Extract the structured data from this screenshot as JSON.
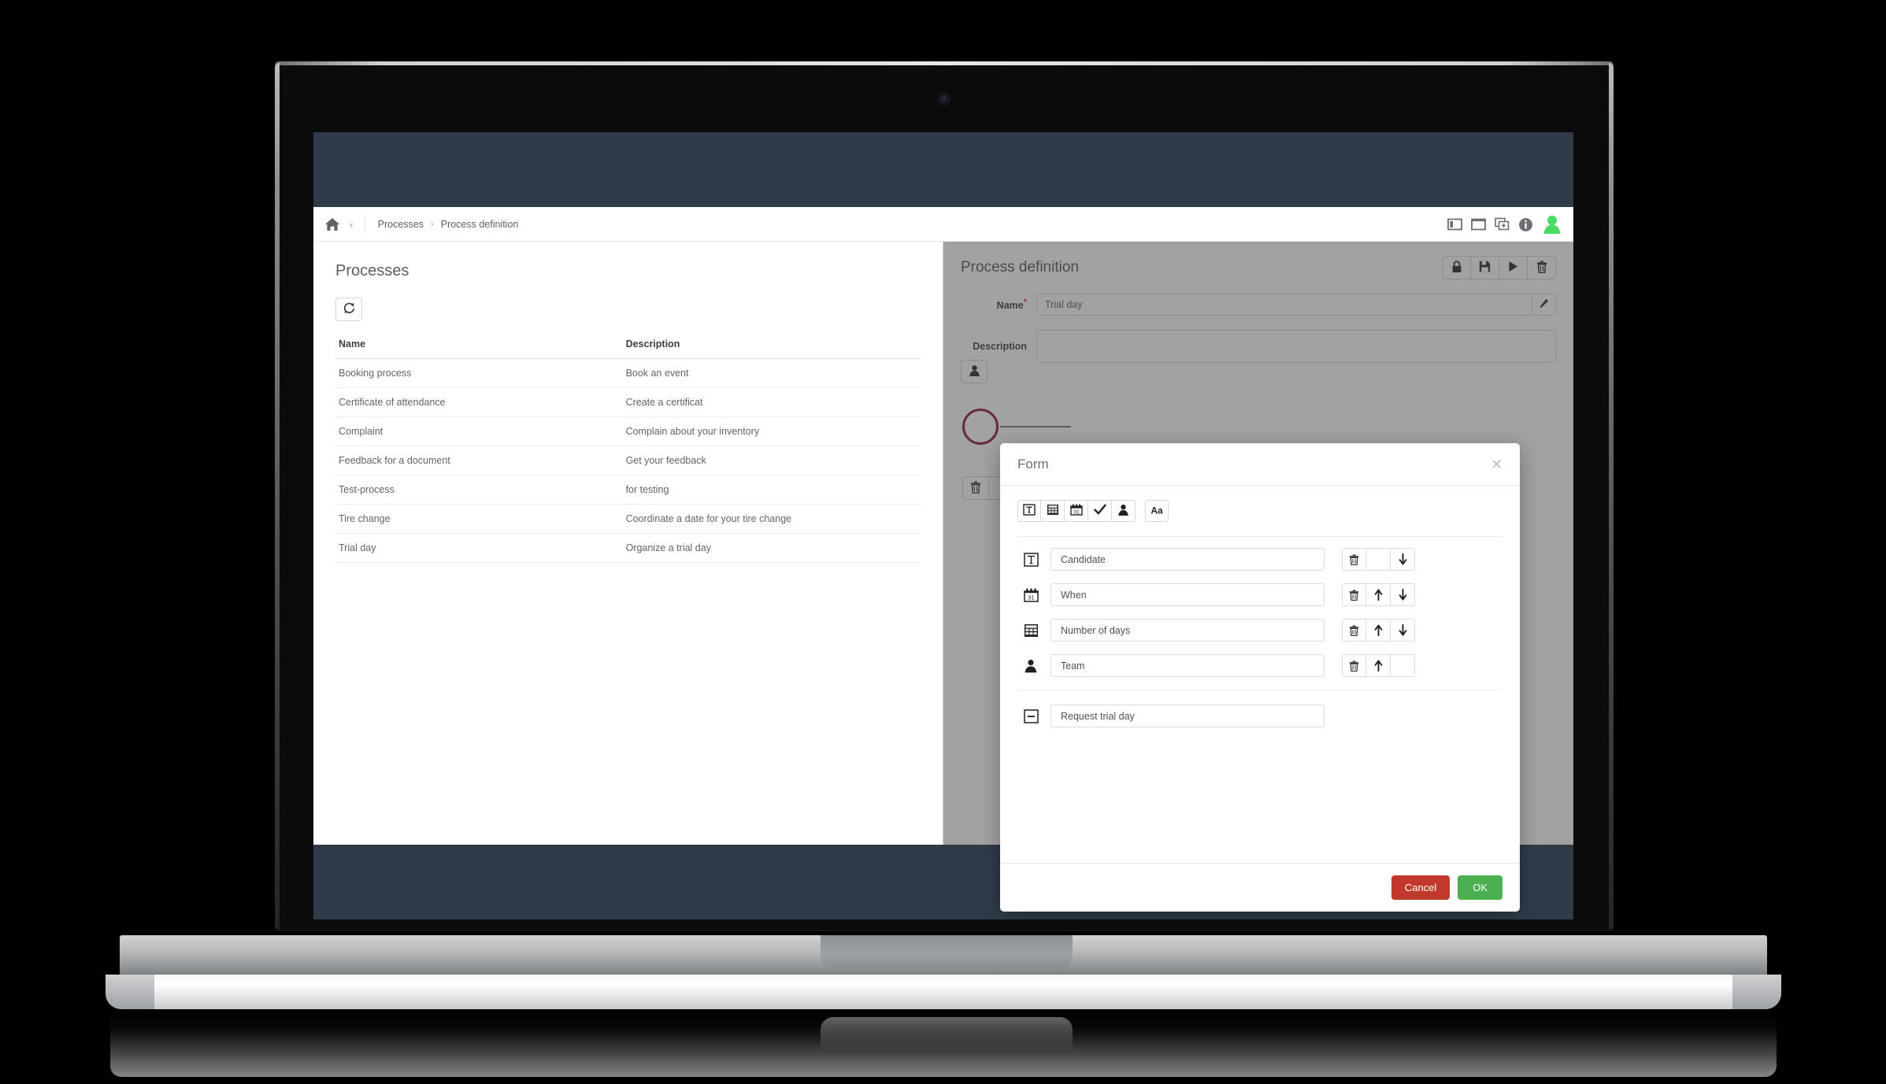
{
  "topbar": {
    "home_icon": "home-icon",
    "back_icon": "chevron-left-icon",
    "breadcrumbs": [
      "Processes",
      "Process definition"
    ],
    "crumb_separator": "›",
    "icons": [
      "split-pane-icon",
      "single-pane-icon",
      "duplicate-pane-icon",
      "info-icon",
      "user-avatar-icon"
    ],
    "avatar_color": "#4cd964"
  },
  "left_pane": {
    "title": "Processes",
    "refresh_icon": "refresh-icon",
    "table": {
      "columns": [
        "Name",
        "Description"
      ],
      "rows": [
        {
          "name": "Booking process",
          "description": "Book an event"
        },
        {
          "name": "Certificate of attendance",
          "description": "Create a certificat"
        },
        {
          "name": "Complaint",
          "description": "Complain about your inventory"
        },
        {
          "name": "Feedback for a document",
          "description": "Get your feedback"
        },
        {
          "name": "Test-process",
          "description": "for testing"
        },
        {
          "name": "Tire change",
          "description": "Coordinate a date for your tire change"
        },
        {
          "name": "Trial day",
          "description": "Organize a trial day"
        }
      ]
    }
  },
  "right_pane": {
    "title": "Process definition",
    "actions": [
      "lock-icon",
      "save-icon",
      "play-icon",
      "trash-icon"
    ],
    "name_label": "Name",
    "required_marker": "*",
    "name_value": "Trial day",
    "pencil_icon": "pencil-icon",
    "description_label": "Description",
    "description_value": "",
    "palette_icon": "user-task-icon",
    "start_event_name": "start-event",
    "start_event_color": "#8e1c3a",
    "canvas_trash_icon": "trash-icon"
  },
  "modal": {
    "title": "Form",
    "close_icon": "close-icon",
    "toolbar": [
      {
        "icon": "text-field-icon",
        "group": 1
      },
      {
        "icon": "number-field-icon",
        "group": 1
      },
      {
        "icon": "date-field-icon",
        "group": 1
      },
      {
        "icon": "checkbox-field-icon",
        "group": 1
      },
      {
        "icon": "person-field-icon",
        "group": 1
      },
      {
        "icon": "label-field-icon",
        "group": 2
      }
    ],
    "fields": [
      {
        "icon": "text-field-icon",
        "value": "Candidate",
        "actions": [
          "trash-icon",
          "",
          "arrow-down-icon"
        ]
      },
      {
        "icon": "date-field-icon",
        "value": "When",
        "actions": [
          "trash-icon",
          "arrow-up-icon",
          "arrow-down-icon"
        ]
      },
      {
        "icon": "number-field-icon",
        "value": "Number of days",
        "actions": [
          "trash-icon",
          "arrow-up-icon",
          "arrow-down-icon"
        ]
      },
      {
        "icon": "person-field-icon",
        "value": "Team",
        "actions": [
          "trash-icon",
          "arrow-up-icon",
          ""
        ]
      }
    ],
    "footer_field": {
      "icon": "minus-box-icon",
      "value": "Request trial day"
    },
    "buttons": {
      "cancel": "Cancel",
      "ok": "OK"
    },
    "cancel_color": "#c0392b",
    "ok_color": "#4cb050"
  }
}
